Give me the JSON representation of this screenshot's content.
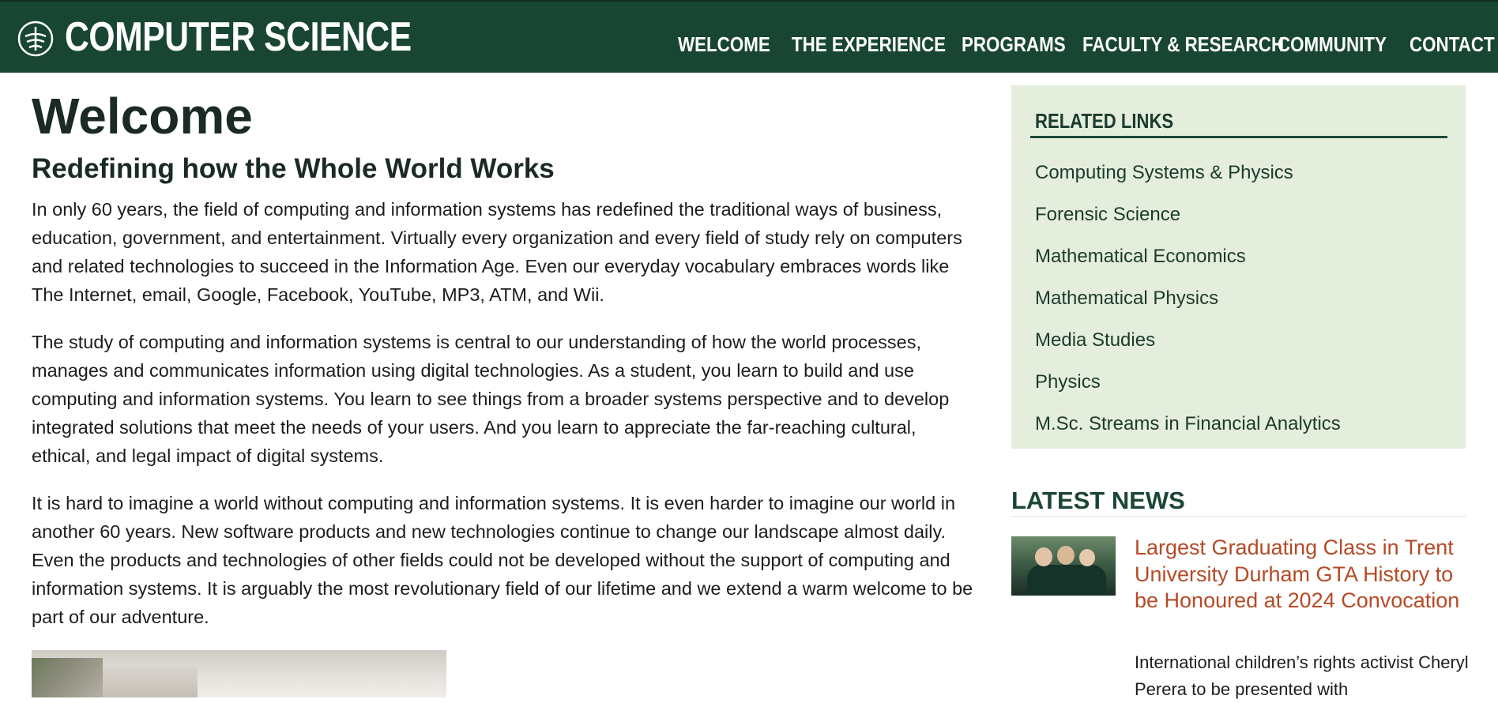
{
  "header": {
    "site_title": "COMPUTER SCIENCE",
    "logo_icon": "trent-university-logo-icon",
    "background_color": "#184632",
    "nav": [
      "WELCOME",
      "THE EXPERIENCE",
      "PROGRAMS",
      "FACULTY & RESEARCH",
      "COMMUNITY",
      "CONTACT"
    ]
  },
  "main": {
    "title": "Welcome",
    "subtitle": "Redefining how the Whole World Works",
    "paragraphs": [
      "In only 60 years, the field of computing and information systems has redefined the traditional ways of business, education, government, and entertainment.  Virtually every organization and every field of study rely on computers and related technologies to succeed in the Information Age.  Even our everyday vocabulary embraces words like The Internet, email, Google, Facebook, YouTube, MP3, ATM, and Wii.",
      "The study of computing and information systems is central to our understanding of how the world processes, manages and communicates information using digital technologies.  As a student, you learn to build and use computing and information systems.  You learn to see things from a broader systems perspective and to develop integrated solutions that meet the needs of your users.  And you learn to appreciate the far-reaching cultural, ethical, and legal impact of digital systems.",
      "It is hard to imagine a world without computing and information systems.  It is even harder to imagine our world in another 60 years.  New software products and new technologies continue to change our landscape almost daily.  Even the products and technologies of other fields could not be developed without the support of computing and information systems.  It is arguably the most revolutionary field of our lifetime and we extend a warm welcome to be part of our adventure."
    ]
  },
  "sidebar": {
    "related_title": "RELATED LINKS",
    "related_links": [
      "Computing Systems & Physics",
      "Forensic Science",
      "Mathematical Economics",
      "Mathematical Physics",
      "Media Studies",
      "Physics",
      "M.Sc. Streams in Financial Analytics"
    ],
    "news_title": "LATEST NEWS",
    "news": {
      "headline": "Largest Graduating Class in Trent University Durham GTA History to be Honoured at 2024 Convocation",
      "excerpt": "International children’s rights activist Cheryl Perera to be presented with"
    }
  },
  "colors": {
    "brand_green": "#184632",
    "sidebar_bg": "#e5eedc",
    "headline_link": "#b64a26"
  }
}
